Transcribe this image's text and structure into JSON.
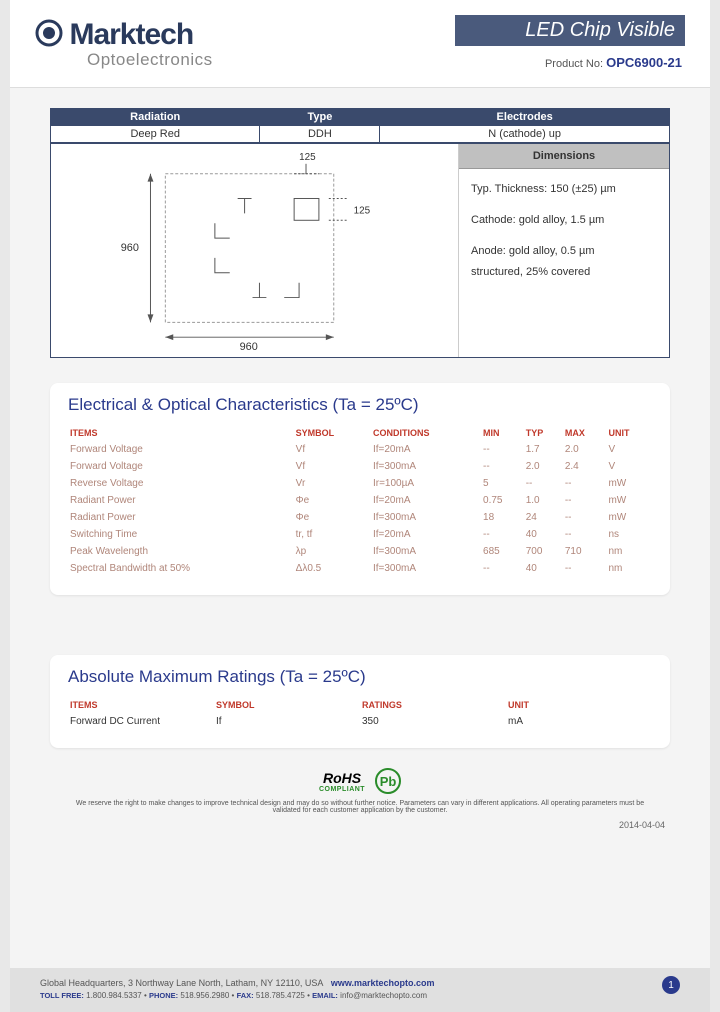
{
  "brand": {
    "name": "Marktech",
    "subtitle": "Optoelectronics"
  },
  "header": {
    "title": "LED Chip Visible",
    "product_no_label": "Product No:",
    "product_no": "OPC6900-21"
  },
  "spec_table": {
    "headers": [
      "Radiation",
      "Type",
      "Electrodes"
    ],
    "row": [
      "Deep Red",
      "DDH",
      "N (cathode) up"
    ]
  },
  "diagram": {
    "dim_w": "960",
    "dim_h": "960",
    "pad_w": "125",
    "pad_h": "125"
  },
  "dimensions": {
    "title": "Dimensions",
    "thickness": "Typ. Thickness: 150 (±25) µm",
    "cathode": "Cathode: gold alloy, 1.5 µm",
    "anode": "Anode: gold alloy, 0.5 µm",
    "structured": "structured, 25% covered"
  },
  "electrical": {
    "title": "Electrical & Optical Characteristics (Ta = 25ºC)",
    "headers": [
      "ITEMS",
      "SYMBOL",
      "CONDITIONS",
      "MIN",
      "TYP",
      "MAX",
      "UNIT"
    ],
    "rows": [
      [
        "Forward Voltage",
        "Vf",
        "If=20mA",
        "--",
        "1.7",
        "2.0",
        "V"
      ],
      [
        "Forward Voltage",
        "Vf",
        "If=300mA",
        "--",
        "2.0",
        "2.4",
        "V"
      ],
      [
        "Reverse Voltage",
        "Vr",
        "Ir=100µA",
        "5",
        "--",
        "--",
        "mW"
      ],
      [
        "Radiant Power",
        "Φe",
        "If=20mA",
        "0.75",
        "1.0",
        "--",
        "mW"
      ],
      [
        "Radiant Power",
        "Φe",
        "If=300mA",
        "18",
        "24",
        "--",
        "mW"
      ],
      [
        "Switching Time",
        "tr, tf",
        "If=20mA",
        "--",
        "40",
        "--",
        "ns"
      ],
      [
        "Peak Wavelength",
        "λp",
        "If=300mA",
        "685",
        "700",
        "710",
        "nm"
      ],
      [
        "Spectral Bandwidth at 50%",
        "Δλ0.5",
        "If=300mA",
        "--",
        "40",
        "--",
        "nm"
      ]
    ]
  },
  "absolute": {
    "title": "Absolute Maximum Ratings (Ta = 25ºC)",
    "headers": [
      "ITEMS",
      "SYMBOL",
      "RATINGS",
      "UNIT"
    ],
    "rows": [
      [
        "Forward DC Current",
        "If",
        "350",
        "mA"
      ]
    ]
  },
  "compliance": {
    "rohs": "RoHS",
    "rohs_sub": "COMPLIANT",
    "pb": "Pb",
    "disclaimer": "We reserve the right to make changes to improve technical design and may do so without further notice. Parameters can vary in different applications. All operating parameters must be validated for each customer application by the customer.",
    "date": "2014-04-04"
  },
  "footer": {
    "address": "Global Headquarters, 3 Northway Lane North, Latham, NY 12110, USA",
    "web": "www.marktechopto.com",
    "toll_free_lbl": "TOLL FREE:",
    "toll_free": "1.800.984.5337",
    "phone_lbl": "PHONE:",
    "phone": "518.956.2980",
    "fax_lbl": "FAX:",
    "fax": "518.785.4725",
    "email_lbl": "EMAIL:",
    "email": "info@marktechopto.com",
    "page": "1"
  }
}
